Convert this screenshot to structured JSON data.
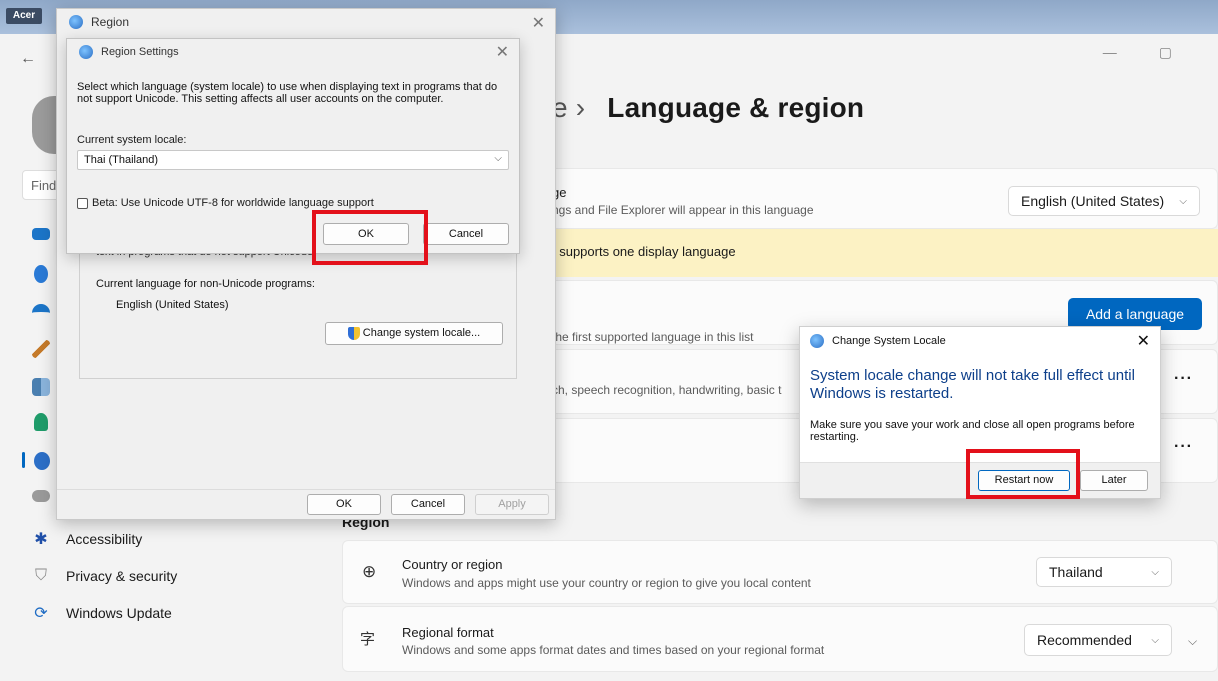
{
  "taskbar": {
    "brand": "Acer"
  },
  "settings": {
    "window_min": "—",
    "window_max": "▢",
    "page_title_crumb": "e  ›",
    "page_title": "Language & region",
    "search_placeholder": "Find",
    "nav": [
      {
        "label": "Accessibility"
      },
      {
        "label": "Privacy & security"
      },
      {
        "label": "Windows Update"
      }
    ],
    "display_lang_title_fragment": "ge",
    "display_lang_desc_fragment": "ngs and File Explorer will appear in this language",
    "display_lang_value": "English (United States)",
    "yellow_notice_fragment": "/ supports one display language",
    "add_language_label": "Add a language",
    "preferred_desc_fragment": "the first supported language in this list",
    "lang_features_fragment": "ch, speech recognition, handwriting, basic t",
    "more_dots": "···",
    "region_header": "Region",
    "country": {
      "title": "Country or region",
      "desc": "Windows and apps might use your country or region to give you local content",
      "value": "Thailand"
    },
    "regional_format": {
      "title": "Regional format",
      "desc": "Windows and some apps format dates and times based on your regional format",
      "value": "Recommended"
    }
  },
  "region_dialog": {
    "title": "Region",
    "obscured_text": "text in programs that do not support Unicode.",
    "current_lang_label": "Current language for non-Unicode programs:",
    "current_lang_value": "English (United States)",
    "change_locale_btn": "Change system locale...",
    "ok": "OK",
    "cancel": "Cancel",
    "apply": "Apply"
  },
  "region_settings": {
    "title": "Region Settings",
    "description": "Select which language (system locale) to use when displaying text in programs that do not support Unicode. This setting affects all user accounts on the computer.",
    "locale_label": "Current system locale:",
    "locale_value": "Thai (Thailand)",
    "beta_label": "Beta: Use Unicode UTF-8 for worldwide language support",
    "ok": "OK",
    "cancel": "Cancel"
  },
  "change_locale_dialog": {
    "title": "Change System Locale",
    "headline": "System locale change will not take full effect until Windows is restarted.",
    "body": "Make sure you save your work and close all open programs before restarting.",
    "restart": "Restart now",
    "later": "Later"
  },
  "colors": {
    "accent": "#0067c0",
    "highlight": "#e3101a",
    "notice": "#fcf2c4"
  }
}
